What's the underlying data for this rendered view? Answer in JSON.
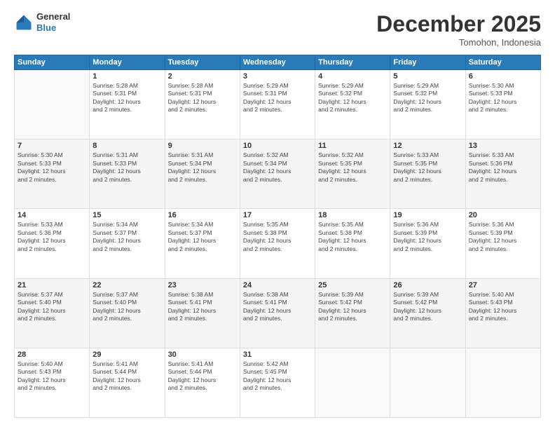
{
  "logo": {
    "general": "General",
    "blue": "Blue"
  },
  "title": "December 2025",
  "location": "Tomohon, Indonesia",
  "days_header": [
    "Sunday",
    "Monday",
    "Tuesday",
    "Wednesday",
    "Thursday",
    "Friday",
    "Saturday"
  ],
  "weeks": [
    [
      {
        "day": "",
        "info": ""
      },
      {
        "day": "1",
        "info": "Sunrise: 5:28 AM\nSunset: 5:31 PM\nDaylight: 12 hours\nand 2 minutes."
      },
      {
        "day": "2",
        "info": "Sunrise: 5:28 AM\nSunset: 5:31 PM\nDaylight: 12 hours\nand 2 minutes."
      },
      {
        "day": "3",
        "info": "Sunrise: 5:29 AM\nSunset: 5:31 PM\nDaylight: 12 hours\nand 2 minutes."
      },
      {
        "day": "4",
        "info": "Sunrise: 5:29 AM\nSunset: 5:32 PM\nDaylight: 12 hours\nand 2 minutes."
      },
      {
        "day": "5",
        "info": "Sunrise: 5:29 AM\nSunset: 5:32 PM\nDaylight: 12 hours\nand 2 minutes."
      },
      {
        "day": "6",
        "info": "Sunrise: 5:30 AM\nSunset: 5:33 PM\nDaylight: 12 hours\nand 2 minutes."
      }
    ],
    [
      {
        "day": "7",
        "info": "Sunrise: 5:30 AM\nSunset: 5:33 PM\nDaylight: 12 hours\nand 2 minutes."
      },
      {
        "day": "8",
        "info": "Sunrise: 5:31 AM\nSunset: 5:33 PM\nDaylight: 12 hours\nand 2 minutes."
      },
      {
        "day": "9",
        "info": "Sunrise: 5:31 AM\nSunset: 5:34 PM\nDaylight: 12 hours\nand 2 minutes."
      },
      {
        "day": "10",
        "info": "Sunrise: 5:32 AM\nSunset: 5:34 PM\nDaylight: 12 hours\nand 2 minutes."
      },
      {
        "day": "11",
        "info": "Sunrise: 5:32 AM\nSunset: 5:35 PM\nDaylight: 12 hours\nand 2 minutes."
      },
      {
        "day": "12",
        "info": "Sunrise: 5:33 AM\nSunset: 5:35 PM\nDaylight: 12 hours\nand 2 minutes."
      },
      {
        "day": "13",
        "info": "Sunrise: 5:33 AM\nSunset: 5:36 PM\nDaylight: 12 hours\nand 2 minutes."
      }
    ],
    [
      {
        "day": "14",
        "info": "Sunrise: 5:33 AM\nSunset: 5:36 PM\nDaylight: 12 hours\nand 2 minutes."
      },
      {
        "day": "15",
        "info": "Sunrise: 5:34 AM\nSunset: 5:37 PM\nDaylight: 12 hours\nand 2 minutes."
      },
      {
        "day": "16",
        "info": "Sunrise: 5:34 AM\nSunset: 5:37 PM\nDaylight: 12 hours\nand 2 minutes."
      },
      {
        "day": "17",
        "info": "Sunrise: 5:35 AM\nSunset: 5:38 PM\nDaylight: 12 hours\nand 2 minutes."
      },
      {
        "day": "18",
        "info": "Sunrise: 5:35 AM\nSunset: 5:38 PM\nDaylight: 12 hours\nand 2 minutes."
      },
      {
        "day": "19",
        "info": "Sunrise: 5:36 AM\nSunset: 5:39 PM\nDaylight: 12 hours\nand 2 minutes."
      },
      {
        "day": "20",
        "info": "Sunrise: 5:36 AM\nSunset: 5:39 PM\nDaylight: 12 hours\nand 2 minutes."
      }
    ],
    [
      {
        "day": "21",
        "info": "Sunrise: 5:37 AM\nSunset: 5:40 PM\nDaylight: 12 hours\nand 2 minutes."
      },
      {
        "day": "22",
        "info": "Sunrise: 5:37 AM\nSunset: 5:40 PM\nDaylight: 12 hours\nand 2 minutes."
      },
      {
        "day": "23",
        "info": "Sunrise: 5:38 AM\nSunset: 5:41 PM\nDaylight: 12 hours\nand 2 minutes."
      },
      {
        "day": "24",
        "info": "Sunrise: 5:38 AM\nSunset: 5:41 PM\nDaylight: 12 hours\nand 2 minutes."
      },
      {
        "day": "25",
        "info": "Sunrise: 5:39 AM\nSunset: 5:42 PM\nDaylight: 12 hours\nand 2 minutes."
      },
      {
        "day": "26",
        "info": "Sunrise: 5:39 AM\nSunset: 5:42 PM\nDaylight: 12 hours\nand 2 minutes."
      },
      {
        "day": "27",
        "info": "Sunrise: 5:40 AM\nSunset: 5:43 PM\nDaylight: 12 hours\nand 2 minutes."
      }
    ],
    [
      {
        "day": "28",
        "info": "Sunrise: 5:40 AM\nSunset: 5:43 PM\nDaylight: 12 hours\nand 2 minutes."
      },
      {
        "day": "29",
        "info": "Sunrise: 5:41 AM\nSunset: 5:44 PM\nDaylight: 12 hours\nand 2 minutes."
      },
      {
        "day": "30",
        "info": "Sunrise: 5:41 AM\nSunset: 5:44 PM\nDaylight: 12 hours\nand 2 minutes."
      },
      {
        "day": "31",
        "info": "Sunrise: 5:42 AM\nSunset: 5:45 PM\nDaylight: 12 hours\nand 2 minutes."
      },
      {
        "day": "",
        "info": ""
      },
      {
        "day": "",
        "info": ""
      },
      {
        "day": "",
        "info": ""
      }
    ]
  ]
}
